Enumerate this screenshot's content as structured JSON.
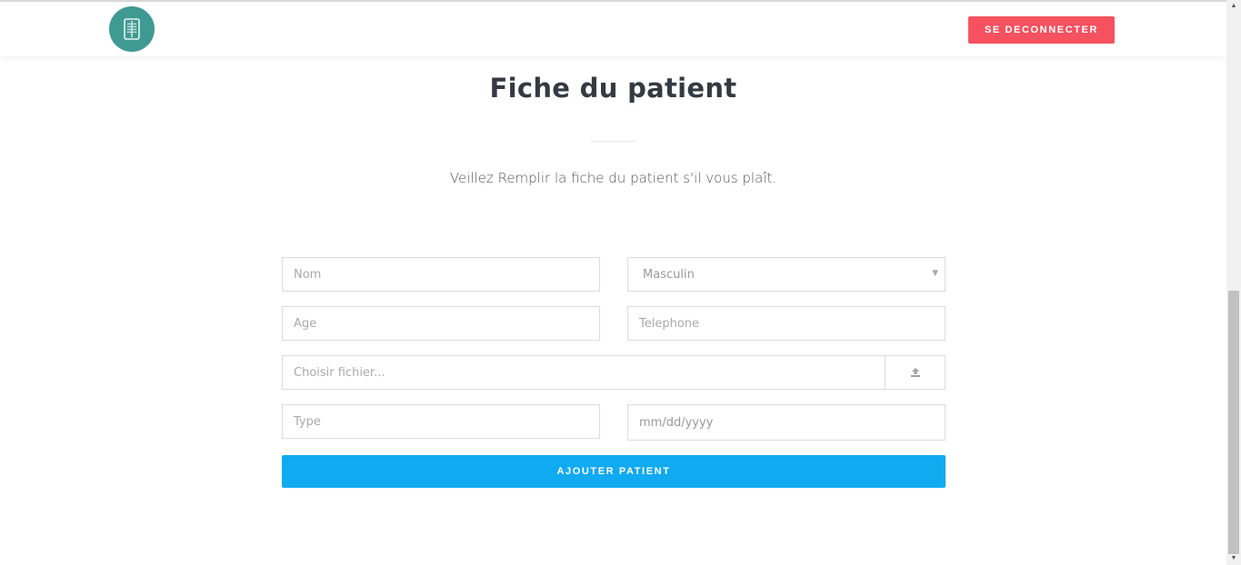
{
  "header": {
    "logo_icon": "lungs-xray-icon",
    "logout_label": "SE DECONNECTER"
  },
  "main": {
    "title": "Fiche du patient",
    "subtitle": "Veillez Remplir la fiche du patient s'il vous plaît."
  },
  "form": {
    "nom_placeholder": "Nom",
    "sexe_selected": "Masculin",
    "age_placeholder": "Age",
    "telephone_placeholder": "Telephone",
    "fichier_placeholder": "Choisir fichier...",
    "upload_icon": "upload-icon",
    "type_placeholder": "Type",
    "date_placeholder": "mm/dd/yyyy",
    "submit_label": "AJOUTER PATIENT"
  },
  "colors": {
    "logo_bg": "#3f9a92",
    "logout_bg": "#f5515f",
    "submit_bg": "#10aaf0"
  }
}
